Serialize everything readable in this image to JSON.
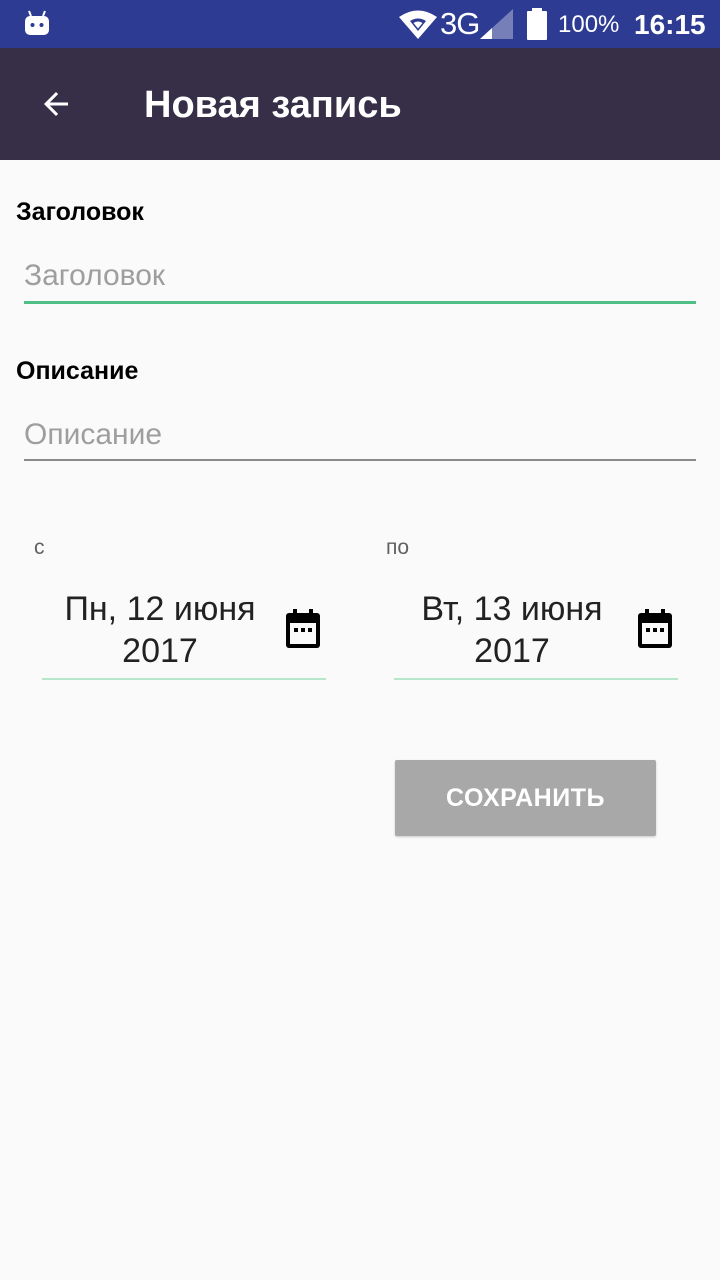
{
  "status_bar": {
    "network": "3G",
    "battery": "100%",
    "time": "16:15",
    "icons": [
      "android-notification-icon",
      "wifi-icon",
      "signal-icon",
      "battery-icon"
    ]
  },
  "app_bar": {
    "title": "Новая запись",
    "back_icon": "arrow-back-icon"
  },
  "form": {
    "title_label": "Заголовок",
    "title_value": "",
    "title_placeholder": "Заголовок",
    "description_label": "Описание",
    "description_value": "",
    "description_placeholder": "Описание",
    "from_label": "с",
    "from_date_line1": "Пн, 12 июня",
    "from_date_line2": "2017",
    "to_label": "по",
    "to_date_line1": "Вт, 13 июня",
    "to_date_line2": "2017",
    "date_icon": "calendar-icon",
    "save_label": "СОХРАНИТЬ"
  },
  "colors": {
    "status_bar": "#2d3b93",
    "app_bar": "#372f47",
    "accent": "#4fbf85",
    "save_button_disabled": "#a8a8a8",
    "background": "#fafafa"
  }
}
